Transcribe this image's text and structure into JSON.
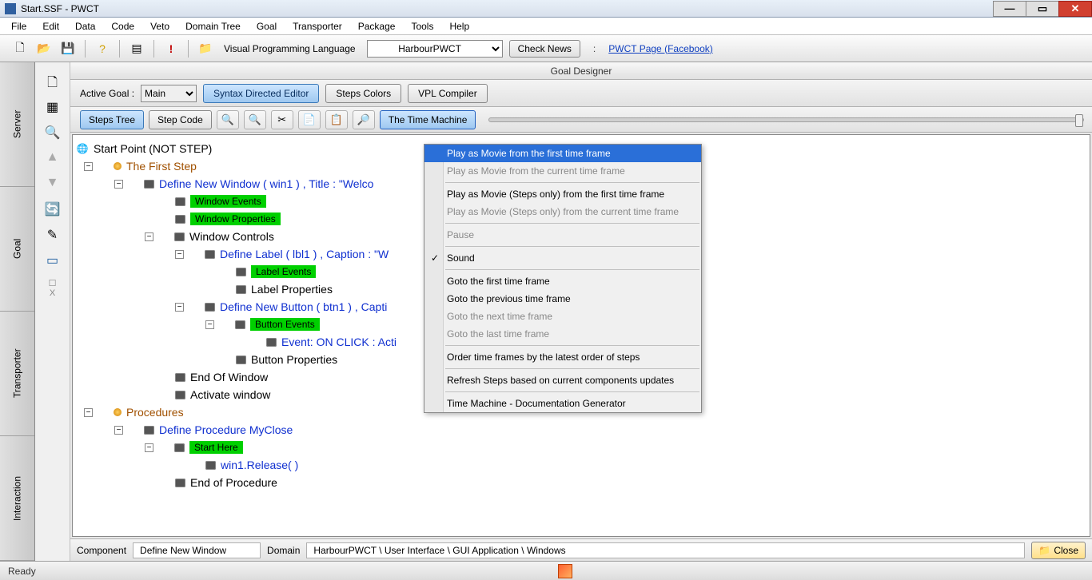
{
  "window": {
    "title": "Start.SSF - PWCT"
  },
  "menu": [
    "File",
    "Edit",
    "Data",
    "Code",
    "Veto",
    "Domain Tree",
    "Goal",
    "Transporter",
    "Package",
    "Tools",
    "Help"
  ],
  "toolbar": {
    "vpl_label": "Visual Programming Language",
    "vpl_selected": "HarbourPWCT",
    "check_news": "Check News",
    "facebook_link": "PWCT Page (Facebook)"
  },
  "left_tabs": [
    "Server",
    "Goal",
    "Transporter",
    "Interaction"
  ],
  "gd_header": "Goal Designer",
  "goal_row": {
    "active_goal_lbl": "Active Goal :",
    "goal_selected": "Main",
    "syntax_editor": "Syntax Directed Editor",
    "steps_colors": "Steps Colors",
    "vpl_compiler": "VPL Compiler"
  },
  "steps_row": {
    "steps_tree": "Steps Tree",
    "step_code": "Step Code",
    "time_machine": "The Time Machine"
  },
  "tree": {
    "start_point": "Start Point (NOT STEP)",
    "first_step": "The First Step",
    "define_window": "Define New Window  ( win1 ) , Title : \"Welco",
    "window_events": "Window Events",
    "window_properties": "Window Properties",
    "window_controls": "Window Controls",
    "define_label": "Define Label ( lbl1 ) , Caption : \"W",
    "label_events": "Label Events",
    "label_properties": "Label Properties",
    "define_button": "Define New Button ( btn1 ) , Capti",
    "button_events": "Button Events",
    "event_onclick": "Event: ON CLICK : Acti",
    "button_properties": "Button Properties",
    "end_of_window": "End Of Window",
    "activate_window": "Activate window",
    "procedures": "Procedures",
    "define_procedure": "Define Procedure MyClose",
    "start_here": "Start Here",
    "win_release": "win1.Release( )",
    "end_of_procedure": "End of Procedure"
  },
  "dropdown": {
    "items": [
      {
        "label": "Play as Movie from the first time frame",
        "selected": true
      },
      {
        "label": "Play as Movie from the current time frame",
        "disabled": true
      },
      {
        "sep": true
      },
      {
        "label": "Play as Movie (Steps only) from the first time frame"
      },
      {
        "label": "Play as Movie (Steps only) from the current time frame",
        "disabled": true
      },
      {
        "sep": true
      },
      {
        "label": "Pause",
        "disabled": true
      },
      {
        "sep": true
      },
      {
        "label": "Sound",
        "checked": true
      },
      {
        "sep": true
      },
      {
        "label": "Goto the first time frame"
      },
      {
        "label": "Goto the previous time frame"
      },
      {
        "label": "Goto the next time frame",
        "disabled": true
      },
      {
        "label": "Goto the last time frame",
        "disabled": true
      },
      {
        "sep": true
      },
      {
        "label": "Order time frames by the latest order of steps"
      },
      {
        "sep": true
      },
      {
        "label": "Refresh Steps based on current components updates"
      },
      {
        "sep": true
      },
      {
        "label": "Time Machine - Documentation Generator"
      }
    ]
  },
  "info": {
    "component_lbl": "Component",
    "component_val": "Define New Window",
    "domain_lbl": "Domain",
    "domain_val": "HarbourPWCT  \\  User Interface  \\  GUI Application  \\  Windows",
    "close": "Close"
  },
  "status": {
    "ready": "Ready"
  }
}
